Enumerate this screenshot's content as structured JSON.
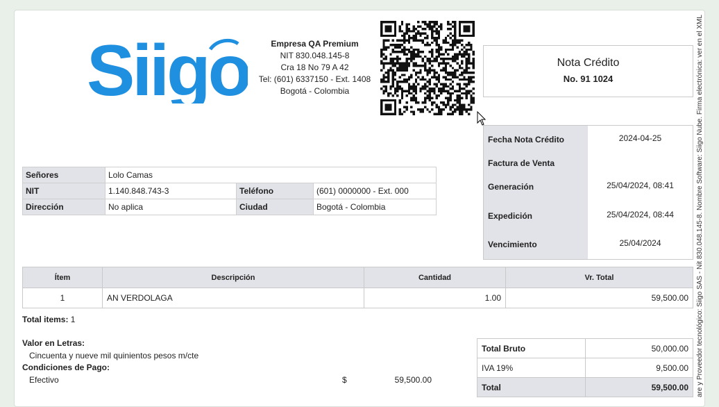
{
  "logo": {
    "text": "Siigo",
    "color": "#1f8fe0"
  },
  "company": {
    "name": "Empresa QA Premium",
    "nit": "NIT 830.048.145-8",
    "address": "Cra 18 No 79 A 42",
    "phone": "Tel: (601) 6337150 - Ext. 1408",
    "city": "Bogotá - Colombia"
  },
  "document": {
    "title": "Nota Crédito",
    "number": "No. 91  1024"
  },
  "dates": [
    {
      "label": "Fecha Nota Crédito",
      "value": "2024-04-25"
    },
    {
      "label": "Factura de Venta",
      "value": ""
    },
    {
      "label": "Generación",
      "value": "25/04/2024, 08:41"
    },
    {
      "label": "Expedición",
      "value": "25/04/2024, 08:44"
    },
    {
      "label": "Vencimiento",
      "value": "25/04/2024"
    }
  ],
  "customer": {
    "senores_label": "Señores",
    "senores_value": "Lolo Camas",
    "nit_label": "NIT",
    "nit_value": "1.140.848.743-3",
    "telefono_label": "Teléfono",
    "telefono_value": "(601) 0000000 - Ext. 000",
    "direccion_label": "Dirección",
    "direccion_value": "No aplica",
    "ciudad_label": "Ciudad",
    "ciudad_value": "Bogotá - Colombia"
  },
  "items": {
    "headers": [
      "Ítem",
      "Descripción",
      "Cantidad",
      "Vr. Total"
    ],
    "rows": [
      {
        "item": "1",
        "description": "AN VERDOLAGA",
        "quantity": "1.00",
        "total": "59,500.00"
      }
    ]
  },
  "summary": {
    "total_items_label": "Total items:",
    "total_items_value": "1",
    "letters_label": "Valor en Letras:",
    "letters_value": "Cincuenta y nueve mil quinientos pesos m/cte",
    "payment_label": "Condiciones de Pago:",
    "payment_method": "Efectivo",
    "payment_currency": "$",
    "payment_amount": "59,500.00"
  },
  "totals": [
    {
      "label": "Total Bruto",
      "value": "50,000.00"
    },
    {
      "label": "IVA 19%",
      "value": "9,500.00"
    },
    {
      "label": "Total",
      "value": "59,500.00"
    }
  ],
  "vertical_text": "are y Proveedor tecnológico: Siigo SAS - Nit 830.048.145-8. Nombre Software: Siigo Nube. Firma electrónica: ver en el XML"
}
